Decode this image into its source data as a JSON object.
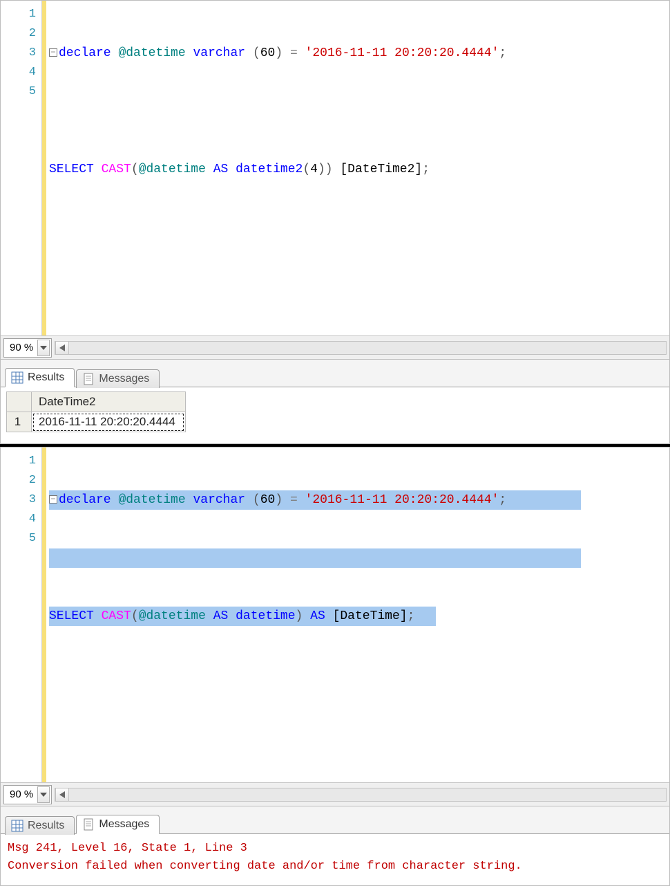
{
  "pane1": {
    "zoom": "90 %",
    "lines": [
      "1",
      "2",
      "3",
      "4",
      "5"
    ],
    "code": {
      "l1": {
        "declare": "declare",
        "var": "@datetime",
        "type": "varchar",
        "paren_open": "(",
        "num": "60",
        "paren_close": ")",
        "eq": " = ",
        "str": "'2016-11-11 20:20:20.4444'",
        "semi": ";"
      },
      "l3": {
        "select": "SELECT",
        "cast": "CAST",
        "paren_open": "(",
        "var": "@datetime",
        "as": "AS",
        "type": "datetime2",
        "p2o": "(",
        "num": "4",
        "p2cc": "))",
        "alias": " [DateTime2]",
        "semi": ";"
      }
    },
    "tabs": {
      "results": "Results",
      "messages": "Messages"
    },
    "grid": {
      "header_blank": "",
      "header_col": "DateTime2",
      "row_num": "1",
      "cell": "2016-11-11 20:20:20.4444"
    }
  },
  "pane2": {
    "zoom": "90 %",
    "lines": [
      "1",
      "2",
      "3",
      "4",
      "5"
    ],
    "code": {
      "l1": {
        "declare": "declare",
        "var": "@datetime",
        "type": "varchar",
        "paren_open": "(",
        "num": "60",
        "paren_close": ")",
        "eq": " = ",
        "str": "'2016-11-11 20:20:20.4444'",
        "semi": ";"
      },
      "l3": {
        "select": "SELECT",
        "cast": "CAST",
        "paren_open": "(",
        "var": "@datetime",
        "as": "AS",
        "type": "datetime",
        "p2c": ")",
        "as2": "AS",
        "alias": " [DateTime]",
        "semi": ";"
      }
    },
    "tabs": {
      "results": "Results",
      "messages": "Messages"
    },
    "error": {
      "line1": "Msg 241, Level 16, State 1, Line 3",
      "line2": "Conversion failed when converting date and/or time from character string."
    }
  }
}
